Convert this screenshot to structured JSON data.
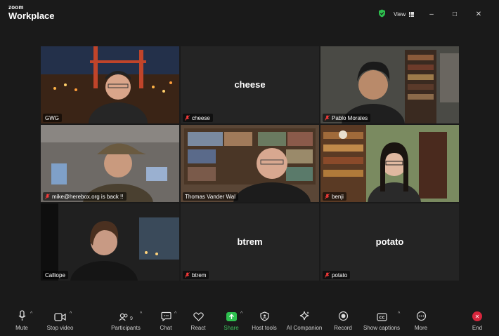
{
  "app": {
    "brand_top": "zoom",
    "brand_bottom": "Workplace"
  },
  "topbar": {
    "view_label": "View",
    "minimize": "–",
    "maximize": "□",
    "close": "✕"
  },
  "tiles": [
    {
      "name": "GWG",
      "muted": false,
      "big_name": "",
      "video": true
    },
    {
      "name": "cheese",
      "muted": true,
      "big_name": "cheese",
      "video": false
    },
    {
      "name": "Pablo Morales",
      "muted": true,
      "big_name": "",
      "video": true
    },
    {
      "name": "mike@herebox.org is back !!",
      "muted": true,
      "big_name": "",
      "video": true
    },
    {
      "name": "Thomas Vander Wal",
      "muted": false,
      "big_name": "",
      "video": true,
      "active_speaker": true
    },
    {
      "name": "benji",
      "muted": true,
      "big_name": "",
      "video": true
    },
    {
      "name": "Calliope",
      "muted": false,
      "big_name": "",
      "video": true
    },
    {
      "name": "btrem",
      "muted": true,
      "big_name": "btrem",
      "video": false
    },
    {
      "name": "potato",
      "muted": true,
      "big_name": "potato",
      "video": false
    }
  ],
  "toolbar": {
    "mute": "Mute",
    "stop_video": "Stop video",
    "participants": "Participants",
    "participants_count": "9",
    "chat": "Chat",
    "react": "React",
    "share": "Share",
    "host_tools": "Host tools",
    "ai_companion": "AI Companion",
    "record": "Record",
    "show_captions": "Show captions",
    "more": "More",
    "end": "End"
  },
  "colors": {
    "accent_green": "#3fbf5e",
    "end_red": "#d7263d",
    "background": "#1a1a1a",
    "tile": "#242424"
  }
}
